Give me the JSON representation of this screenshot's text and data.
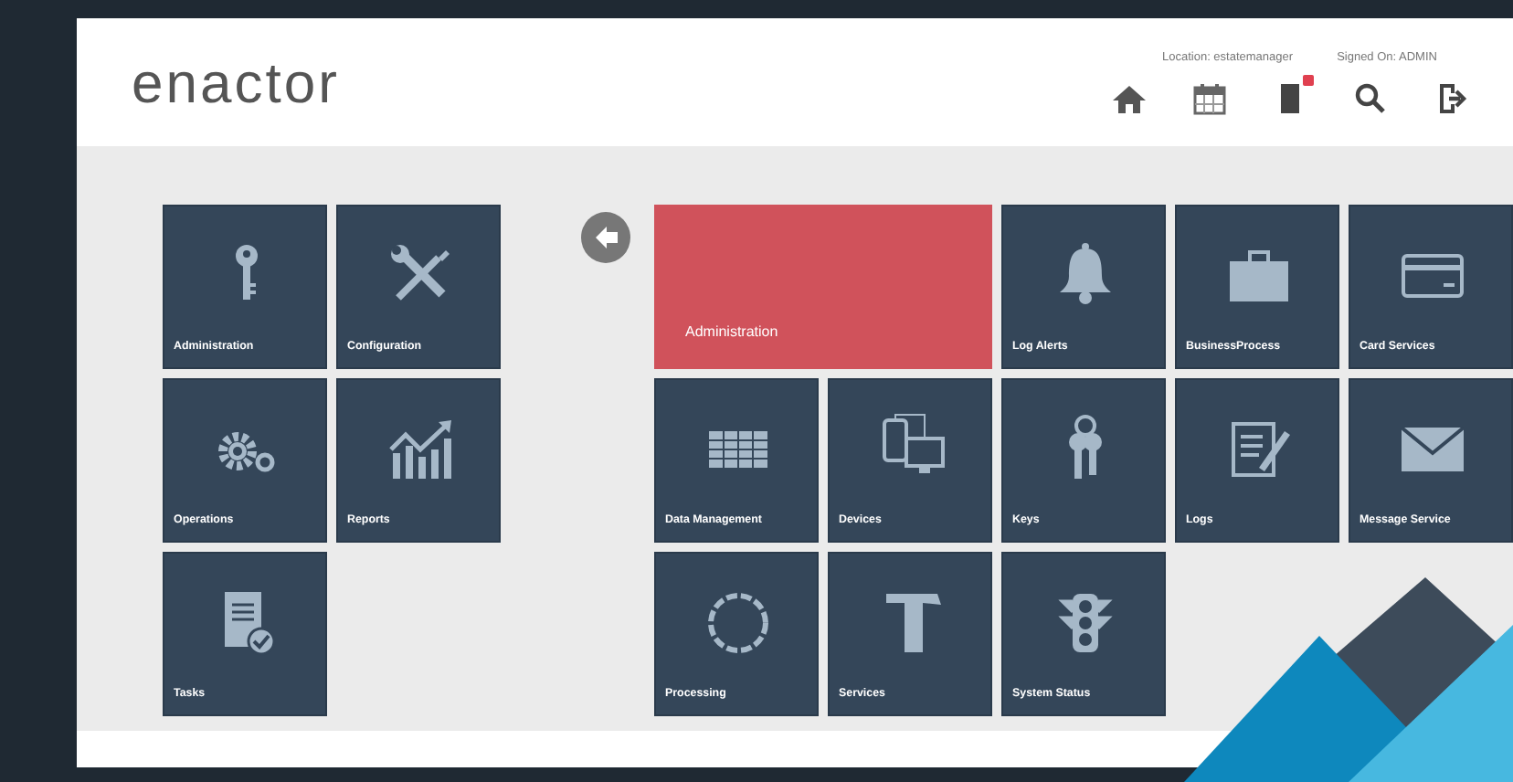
{
  "header": {
    "logo": "enactor",
    "location": "Location: estatemanager",
    "signed_on": "Signed On: ADMIN",
    "notification_badge": true
  },
  "categories": [
    {
      "label": "Administration"
    },
    {
      "label": "Configuration"
    },
    {
      "label": "Operations"
    },
    {
      "label": "Reports"
    },
    {
      "label": "Tasks"
    }
  ],
  "panel": {
    "title": "Administration",
    "items": [
      {
        "label": "Log Alerts"
      },
      {
        "label": "BusinessProcess"
      },
      {
        "label": "Card Services"
      },
      {
        "label": "Data Management"
      },
      {
        "label": "Devices"
      },
      {
        "label": "Keys"
      },
      {
        "label": "Logs"
      },
      {
        "label": "Message Service"
      },
      {
        "label": "Processing"
      },
      {
        "label": "Services"
      },
      {
        "label": "System Status"
      }
    ]
  }
}
